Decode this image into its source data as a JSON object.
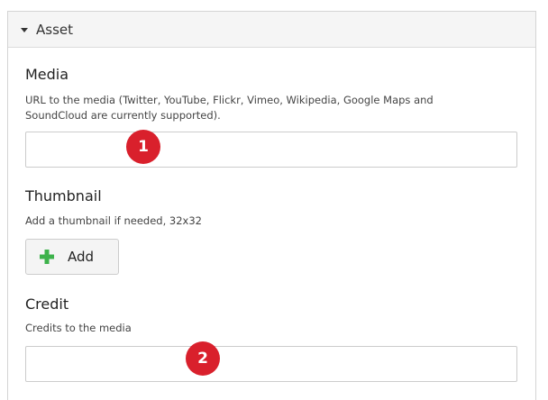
{
  "asset_panel": {
    "title": "Asset",
    "media": {
      "label": "Media",
      "help": "URL to the media (Twitter, YouTube, Flickr, Vimeo, Wikipedia, Google Maps and SoundCloud are currently supported).",
      "value": "",
      "placeholder": ""
    },
    "thumbnail": {
      "label": "Thumbnail",
      "help": "Add a thumbnail if needed, 32x32",
      "add_button_label": "Add",
      "add_button_icon": "plus-icon",
      "icon_color": "#3db24b"
    },
    "credit": {
      "label": "Credit",
      "help": "Credits to the media",
      "value": "",
      "placeholder": ""
    }
  },
  "annotations": {
    "marker_1": "1",
    "marker_2": "2",
    "marker_color": "#d9202c"
  }
}
